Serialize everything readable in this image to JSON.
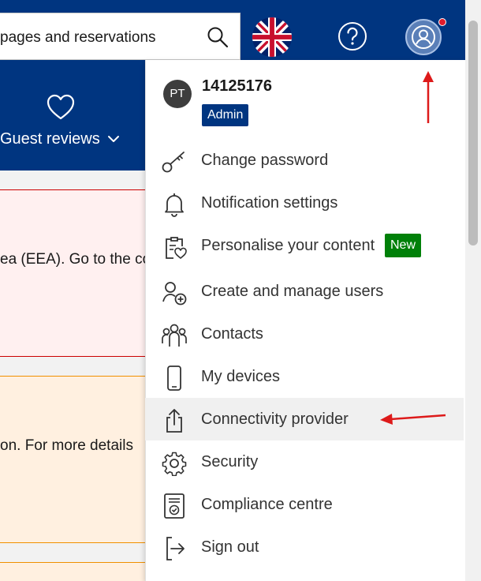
{
  "header": {
    "search_text": "pages and reservations",
    "language": "English (UK)"
  },
  "nav": {
    "guest_reviews_label": "Guest reviews"
  },
  "cards": {
    "red_text": "ea (EEA). Go to the co",
    "orange_text": "on. For more details"
  },
  "account_menu": {
    "avatar_initials": "PT",
    "user_id": "14125176",
    "role": "Admin",
    "items": [
      {
        "label": "Change password",
        "icon": "key-icon"
      },
      {
        "label": "Notification settings",
        "icon": "bell-icon"
      },
      {
        "label": "Personalise your content",
        "icon": "clipboard-heart-icon",
        "badge": "New"
      },
      {
        "label": "Create and manage users",
        "icon": "user-add-icon"
      },
      {
        "label": "Contacts",
        "icon": "people-icon"
      },
      {
        "label": "My devices",
        "icon": "phone-icon"
      },
      {
        "label": "Connectivity provider",
        "icon": "share-icon"
      },
      {
        "label": "Security",
        "icon": "gear-icon"
      },
      {
        "label": "Compliance centre",
        "icon": "certificate-icon"
      },
      {
        "label": "Sign out",
        "icon": "sign-out-icon"
      }
    ]
  },
  "colors": {
    "brand_blue": "#003580",
    "new_badge_green": "#008009",
    "annotation_red": "#dd1a1a"
  }
}
